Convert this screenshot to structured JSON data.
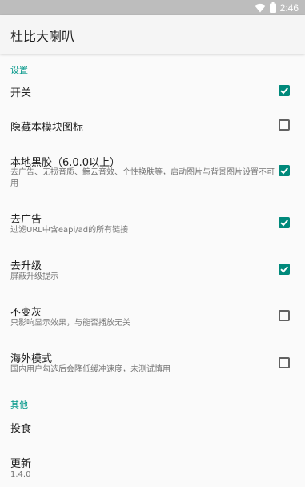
{
  "status_bar": {
    "time": "2:46"
  },
  "app_bar": {
    "title": "杜比大喇叭"
  },
  "sections": {
    "settings": "设置",
    "other": "其他"
  },
  "preferences": [
    {
      "title": "开关",
      "summary": "",
      "checked": true
    },
    {
      "title": "隐藏本模块图标",
      "summary": "",
      "checked": false
    },
    {
      "title": "本地黑胶（6.0.0以上）",
      "summary": "去广告、无损音质、鲸云音效、个性换肤等，启动图片与背景图片设置不可用",
      "checked": true
    },
    {
      "title": "去广告",
      "summary": "过滤URL中含eapi/ad的所有链接",
      "checked": true
    },
    {
      "title": "去升级",
      "summary": "屏蔽升级提示",
      "checked": true
    },
    {
      "title": "不变灰",
      "summary": "只影响显示效果，与能否播放无关",
      "checked": false
    },
    {
      "title": "海外模式",
      "summary": "国内用户勾选后会降低缓冲速度，未测试慎用",
      "checked": false
    }
  ],
  "other_items": [
    {
      "title": "投食",
      "summary": ""
    },
    {
      "title": "更新",
      "summary": "1.4.0"
    }
  ],
  "icons": {
    "wifi": "wifi-icon",
    "battery": "battery-icon",
    "check": "check-icon"
  },
  "colors": {
    "accent": "#009688",
    "checkbox_checked": "#00897b",
    "checkbox_unchecked": "#616161"
  }
}
